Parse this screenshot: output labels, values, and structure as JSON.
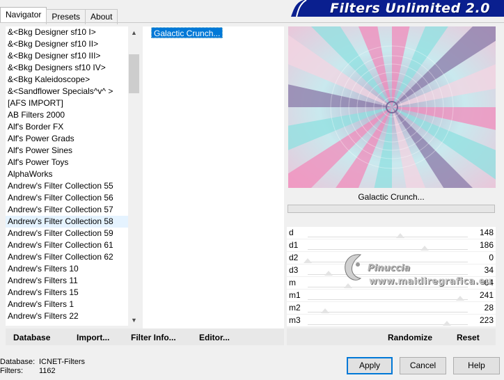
{
  "tabs": [
    {
      "label": "Navigator",
      "active": true
    },
    {
      "label": "Presets",
      "active": false
    },
    {
      "label": "About",
      "active": false
    }
  ],
  "app_title": "Filters Unlimited 2.0",
  "filter_list": [
    "&<Bkg Designer sf10 I>",
    "&<Bkg Designer sf10 II>",
    "&<Bkg Designer sf10 III>",
    "&<Bkg Designers sf10 IV>",
    "&<Bkg Kaleidoscope>",
    "&<Sandflower Specials^v^ >",
    "[AFS IMPORT]",
    "AB Filters 2000",
    "Alf's Border FX",
    "Alf's Power Grads",
    "Alf's Power Sines",
    "Alf's Power Toys",
    "AlphaWorks",
    "Andrew's Filter Collection 55",
    "Andrew's Filter Collection 56",
    "Andrew's Filter Collection 57",
    "Andrew's Filter Collection 58",
    "Andrew's Filter Collection 59",
    "Andrew's Filter Collection 61",
    "Andrew's Filter Collection 62",
    "Andrew's Filters 10",
    "Andrew's Filters 11",
    "Andrew's Filters 15",
    "Andrew's Filters 1",
    "Andrew's Filters 22"
  ],
  "selected_filter": "Andrew's Filter Collection 58",
  "effects": [
    "Galactic Crunch..."
  ],
  "preview_name": "Galactic Crunch...",
  "progress": 0,
  "params": [
    {
      "name": "d",
      "value": "148",
      "level": 0.58
    },
    {
      "name": "d1",
      "value": "186",
      "level": 0.73
    },
    {
      "name": "d2",
      "value": "0",
      "level": 0.0
    },
    {
      "name": "d3",
      "value": "34",
      "level": 0.13
    },
    {
      "name": "m",
      "value": "64",
      "level": 0.25
    },
    {
      "name": "m1",
      "value": "241",
      "level": 0.95
    },
    {
      "name": "m2",
      "value": "28",
      "level": 0.11
    },
    {
      "name": "m3",
      "value": "223",
      "level": 0.87
    }
  ],
  "left_buttons": {
    "database": "Database",
    "import": "Import...",
    "filter_info": "Filter Info...",
    "editor": "Editor..."
  },
  "right_buttons": {
    "randomize": "Randomize",
    "reset": "Reset"
  },
  "info": {
    "database_label": "Database:",
    "database_value": "ICNET-Filters",
    "filters_label": "Filters:",
    "filters_value": "1162"
  },
  "dialog_buttons": {
    "apply": "Apply",
    "cancel": "Cancel",
    "help": "Help"
  },
  "watermark": {
    "name": "Pinuccia",
    "site": "www.maidiregrafica.eu"
  },
  "colors": {
    "selection": "#0078d7",
    "banner": "#0a1f8f",
    "preview_pink": "#f28bbb",
    "preview_cyan": "#8fe0e0",
    "preview_purple": "#8a7aa8"
  }
}
